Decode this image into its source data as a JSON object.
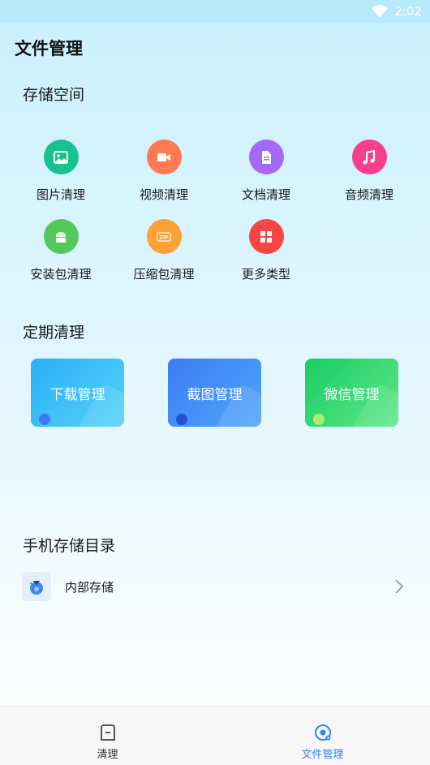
{
  "status_bar": {
    "time": "2:02",
    "icons": [
      "wifi-icon"
    ]
  },
  "page_title": "文件管理",
  "storage_space": {
    "title": "存储空间",
    "items": [
      {
        "label": "图片清理",
        "icon": "image-icon",
        "color": "#17c38d"
      },
      {
        "label": "视频清理",
        "icon": "video-icon",
        "color": "#ff7a52"
      },
      {
        "label": "文档清理",
        "icon": "document-icon",
        "color": "#a56af5"
      },
      {
        "label": "音频清理",
        "icon": "music-icon",
        "color": "#fb3f8f"
      },
      {
        "label": "安装包清理",
        "icon": "android-icon",
        "color": "#52c95a"
      },
      {
        "label": "压缩包清理",
        "icon": "zip-icon",
        "color": "#ffa235"
      },
      {
        "label": "更多类型",
        "icon": "grid-icon",
        "color": "#f94546"
      }
    ]
  },
  "scheduled_clean": {
    "title": "定期清理",
    "cards": [
      {
        "label": "下载管理",
        "colors": [
          "#2ab0f7",
          "#54d2f9"
        ]
      },
      {
        "label": "截图管理",
        "colors": [
          "#3b7cf3",
          "#4fa6fb"
        ]
      },
      {
        "label": "微信管理",
        "colors": [
          "#19cd64",
          "#5fe787"
        ]
      }
    ]
  },
  "phone_storage": {
    "title": "手机存储目录",
    "items": [
      {
        "label": "内部存储",
        "icon": "storage-icon"
      }
    ]
  },
  "bottom_nav": {
    "items": [
      {
        "label": "清理",
        "icon": "clean-icon",
        "active": false
      },
      {
        "label": "文件管理",
        "icon": "file-manage-icon",
        "active": true
      }
    ],
    "active_color": "#2f86f6",
    "inactive_color": "#333333"
  }
}
